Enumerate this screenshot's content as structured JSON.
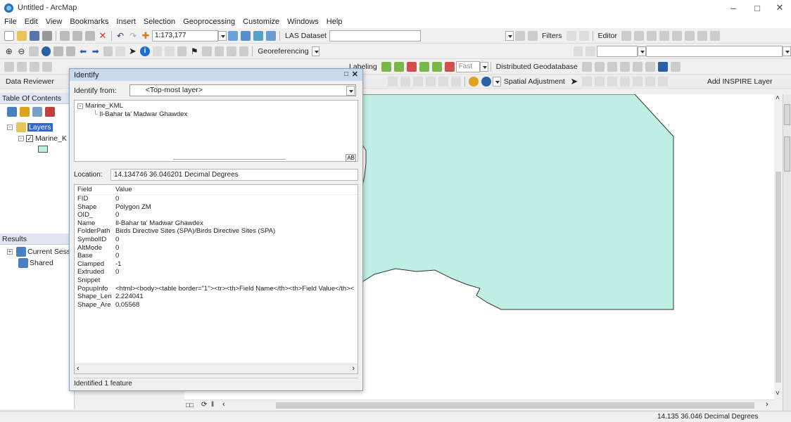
{
  "window": {
    "title": "Untitled - ArcMap"
  },
  "menu": [
    "File",
    "Edit",
    "View",
    "Bookmarks",
    "Insert",
    "Selection",
    "Geoprocessing",
    "Customize",
    "Windows",
    "Help"
  ],
  "toolbar1": {
    "scale": "1:173,177",
    "las_dataset": "LAS Dataset",
    "filters": "Filters",
    "editor": "Editor"
  },
  "toolbar2": {
    "georeferencing": "Georeferencing"
  },
  "toolbar3": {
    "data_reviewer": "Data Reviewer",
    "labeling": "Labeling",
    "fast": "Fast",
    "distributed_geodatabase": "Distributed Geodatabase",
    "spatial_adjustment": "Spatial Adjustment",
    "add_inspire": "Add INSPIRE Layer"
  },
  "toc": {
    "title": "Table Of Contents",
    "layers": "Layers",
    "layer_item": "Marine_K"
  },
  "results": {
    "title": "Results",
    "items": [
      "Current Sessi",
      "Shared"
    ]
  },
  "identify": {
    "title": "Identify",
    "from_label": "Identify from:",
    "from_value": "<Top-most layer>",
    "tree_root": "Marine_KML",
    "tree_child": "Il-Bahar ta' Madwar Ghawdex",
    "location_label": "Location:",
    "location_value": "14.134746  36.046201 Decimal Degrees",
    "grid_header": {
      "field": "Field",
      "value": "Value"
    },
    "rows": [
      {
        "field": "FID",
        "value": "0"
      },
      {
        "field": "Shape",
        "value": "Polygon ZM"
      },
      {
        "field": "OID_",
        "value": "0"
      },
      {
        "field": "Name",
        "value": "Il-Bahar ta' Madwar Ghawdex"
      },
      {
        "field": "FolderPath",
        "value": "Birds Directive Sites (SPA)/Birds Directive Sites (SPA)"
      },
      {
        "field": "SymbolID",
        "value": "0"
      },
      {
        "field": "AltMode",
        "value": "0"
      },
      {
        "field": "Base",
        "value": "0"
      },
      {
        "field": "Clamped",
        "value": "-1"
      },
      {
        "field": "Extruded",
        "value": "0"
      },
      {
        "field": "Snippet",
        "value": ""
      },
      {
        "field": "PopupInfo",
        "value": "<html><body><table border=\"1\"><tr><th>Field Name</th><th>Field Value</th><"
      },
      {
        "field": "Shape_Leng",
        "value": "2.224041"
      },
      {
        "field": "Shape_Area",
        "value": "0.05568"
      }
    ],
    "footer": "Identified 1 feature"
  },
  "status": {
    "coords": "14.135  36.046 Decimal Degrees"
  },
  "colors": {
    "polygon_fill": "#bfeee4",
    "polygon_stroke": "#333333",
    "identify_title_bg": "#c9d9ee",
    "panel_head": "#dfe6ef"
  }
}
